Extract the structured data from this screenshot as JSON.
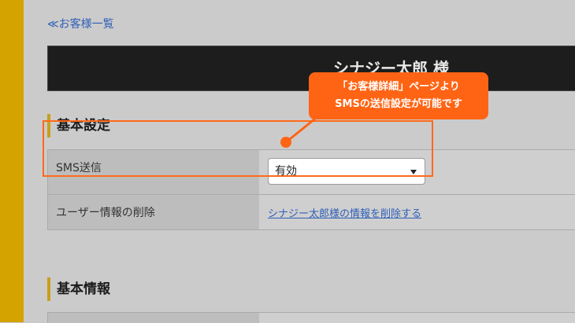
{
  "nav": {
    "back_label": "≪お客様一覧"
  },
  "customer": {
    "title": "シナジー太郎 様"
  },
  "sections": {
    "basic_settings": "基本設定",
    "basic_info": "基本情報"
  },
  "settings": {
    "sms_label": "SMS送信",
    "sms_value": "有効",
    "delete_label": "ユーザー情報の削除",
    "delete_link": "シナジー太郎様の情報を削除する"
  },
  "annotation": {
    "line1": "「お客様詳細」ページより",
    "line2": "SMSの送信設定が可能です"
  },
  "colors": {
    "accent": "#d4a300",
    "callout": "#ff6414",
    "link": "#2f5fb8"
  }
}
